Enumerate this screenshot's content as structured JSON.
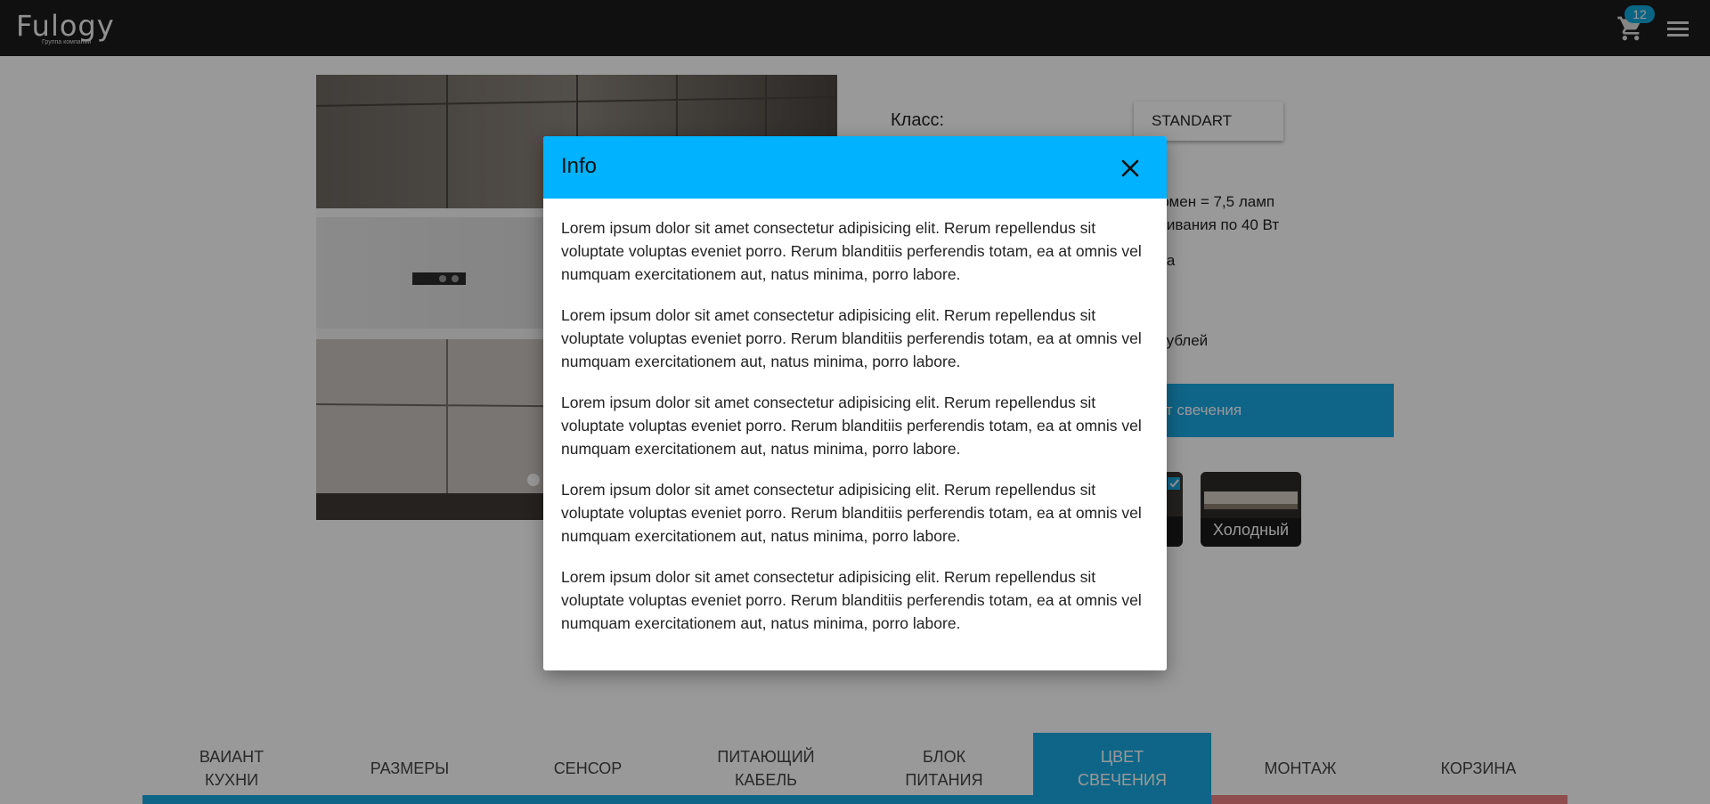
{
  "header": {
    "logo_text": "Fulogy",
    "logo_subtitle": "Группа компаний",
    "cart_count": "12",
    "icons": [
      "cart-icon",
      "menu-icon"
    ]
  },
  "product": {
    "class_label": "Класс:",
    "class_value": "STANDART",
    "spec_line_1": "юмен = 7,5 ламп",
    "spec_line_2": "ливания по 40 Вт",
    "spec_line_3": "да",
    "price_text": "- рублей",
    "choose_button": "ет свечения",
    "option_cold": "Холодный"
  },
  "steps": [
    {
      "label": "ВАИАНТ КУХНИ",
      "active": false
    },
    {
      "label": "РАЗМЕРЫ",
      "active": false
    },
    {
      "label": "СЕНСОР",
      "active": false
    },
    {
      "label": "ПИТАЮЩИЙ КАБЕЛЬ",
      "active": false
    },
    {
      "label": "БЛОК ПИТАНИЯ",
      "active": false
    },
    {
      "label": "ЦВЕТ СВЕЧЕНИЯ",
      "active": true
    },
    {
      "label": "МОНТАЖ",
      "active": false
    },
    {
      "label": "КОРЗИНА",
      "active": false
    }
  ],
  "modal": {
    "title": "Info",
    "paragraphs": [
      "Lorem ipsum dolor sit amet consectetur adipisicing elit. Rerum repellendus sit voluptate voluptas eveniet porro. Rerum blanditiis perferendis totam, ea at omnis vel numquam exercitationem aut, natus minima, porro labore.",
      "Lorem ipsum dolor sit amet consectetur adipisicing elit. Rerum repellendus sit voluptate voluptas eveniet porro. Rerum blanditiis perferendis totam, ea at omnis vel numquam exercitationem aut, natus minima, porro labore.",
      "Lorem ipsum dolor sit amet consectetur adipisicing elit. Rerum repellendus sit voluptate voluptas eveniet porro. Rerum blanditiis perferendis totam, ea at omnis vel numquam exercitationem aut, natus minima, porro labore.",
      "Lorem ipsum dolor sit amet consectetur adipisicing elit. Rerum repellendus sit voluptate voluptas eveniet porro. Rerum blanditiis perferendis totam, ea at omnis vel numquam exercitationem aut, natus minima, porro labore.",
      "Lorem ipsum dolor sit amet consectetur adipisicing elit. Rerum repellendus sit voluptate voluptas eveniet porro. Rerum blanditiis perferendis totam, ea at omnis vel numquam exercitationem aut, natus minima, porro labore."
    ]
  },
  "colors": {
    "header_bg": "#1b1b1b",
    "accent": "#1aa8e2",
    "modal_header": "#00b2ff",
    "progress_remaining": "#f08080"
  }
}
